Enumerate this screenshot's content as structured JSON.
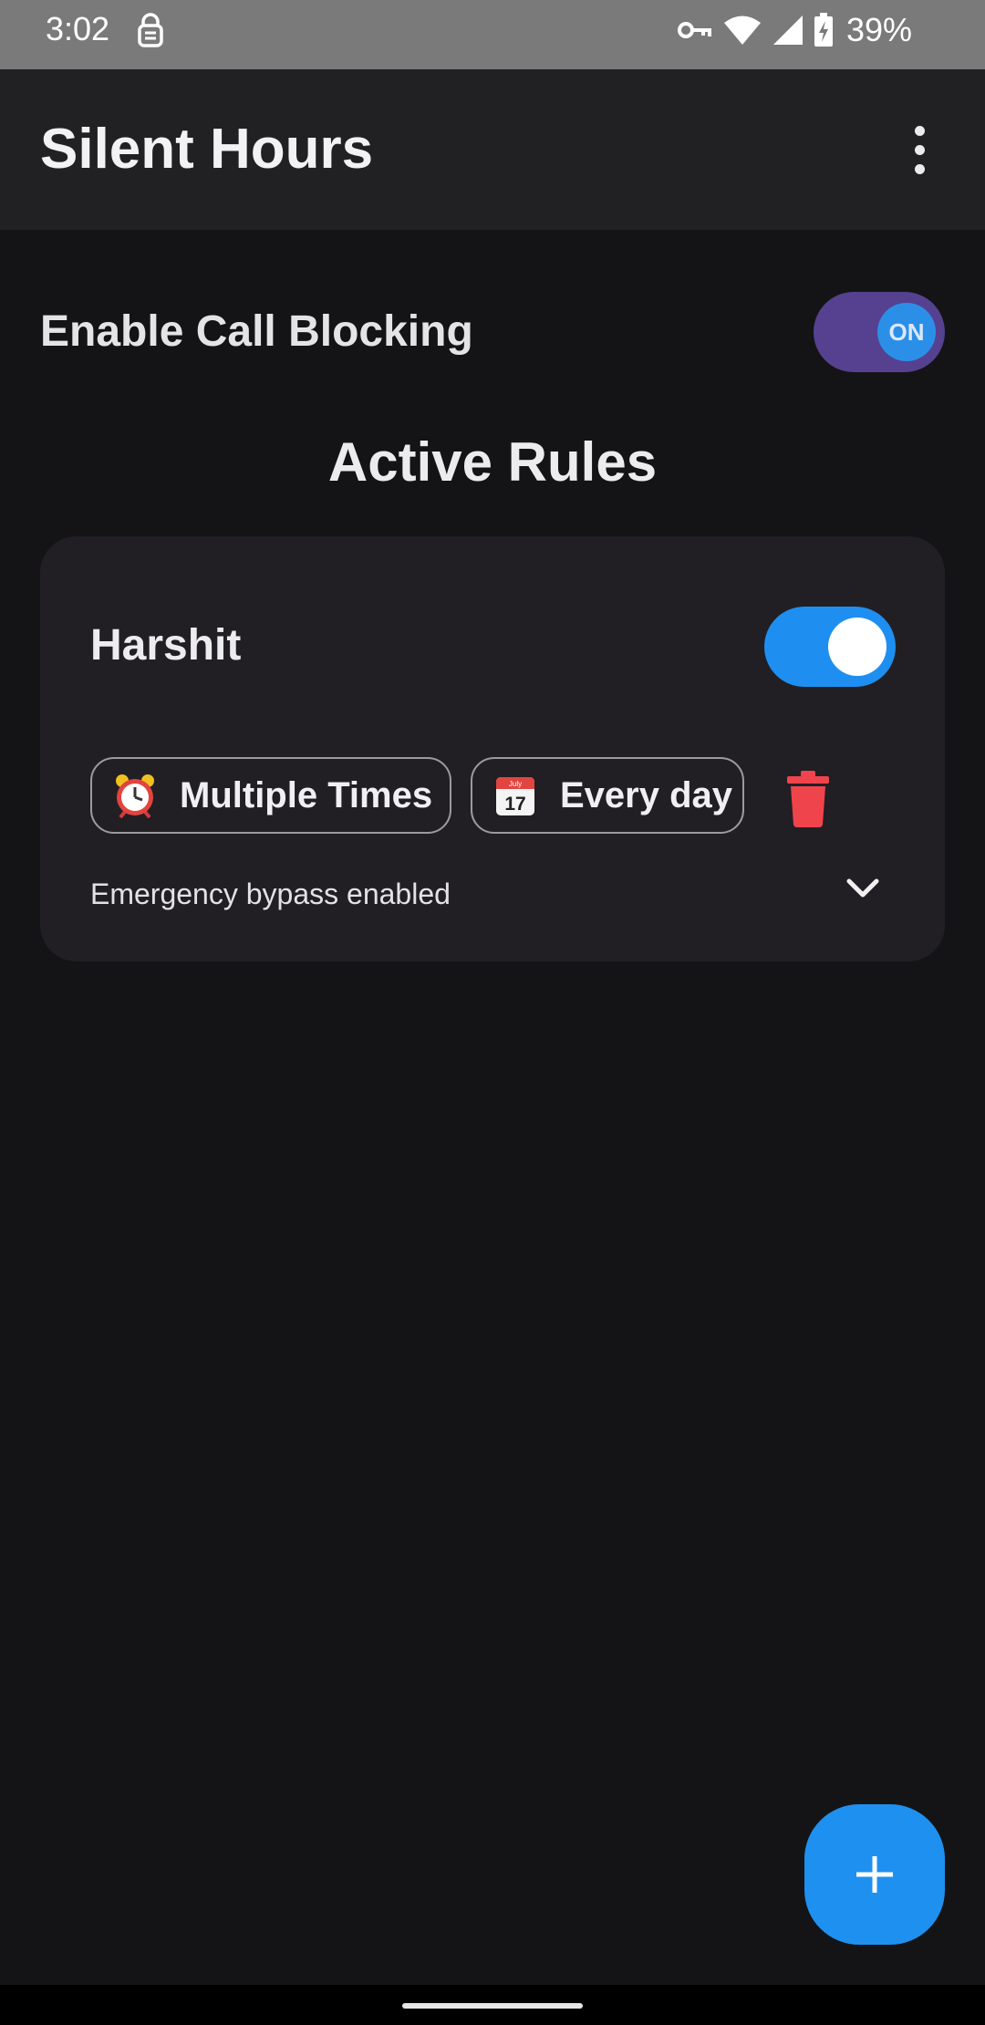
{
  "status_bar": {
    "time": "3:02",
    "battery_percent": "39%",
    "icons": [
      "lock-icon",
      "vpn-key-icon",
      "wifi-icon",
      "signal-icon",
      "battery-charging-icon"
    ]
  },
  "app_bar": {
    "title": "Silent Hours",
    "menu_icon": "overflow-menu-icon"
  },
  "call_blocking": {
    "label": "Enable Call Blocking",
    "toggle_state_label": "ON",
    "enabled": true
  },
  "section": {
    "title": "Active Rules"
  },
  "rules": [
    {
      "name": "Harshit",
      "enabled": true,
      "time_chip": {
        "icon": "alarm-clock-icon",
        "label": "Multiple Times"
      },
      "days_chip": {
        "icon": "calendar-icon",
        "label": "Every day",
        "calendar_month": "July",
        "calendar_day": "17"
      },
      "bypass_text": "Emergency bypass enabled",
      "delete_icon": "trash-icon",
      "expand_icon": "chevron-down-icon"
    }
  ],
  "fab": {
    "icon": "plus-icon"
  },
  "colors": {
    "background": "#141416",
    "app_bar": "#212123",
    "card": "#211f24",
    "accent_blue": "#1e90f0",
    "master_track": "#55418f",
    "delete_red": "#f0444c"
  }
}
